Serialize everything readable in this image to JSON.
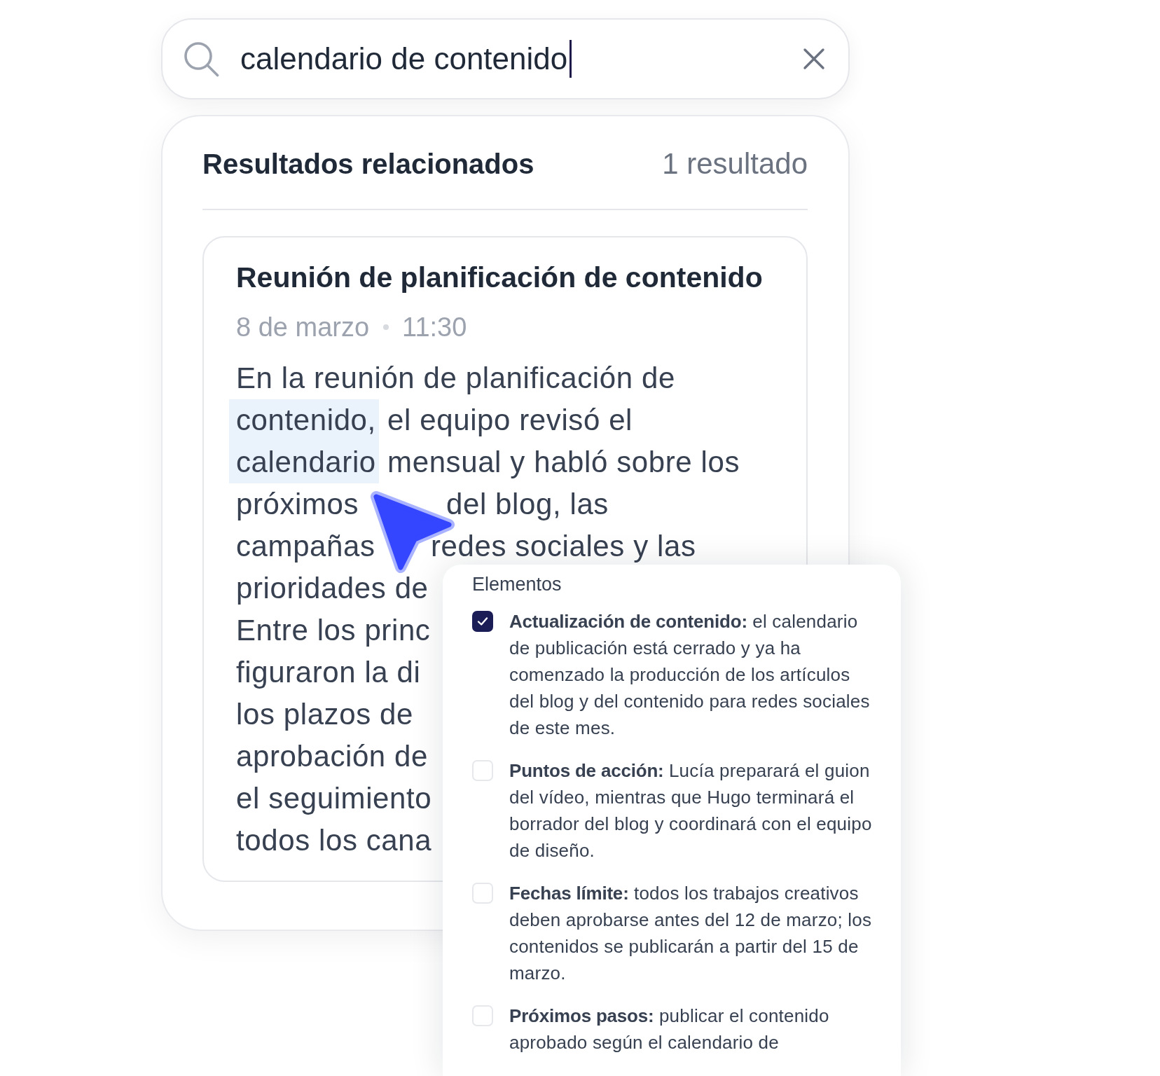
{
  "search": {
    "value": "calendario de contenido",
    "focused": true
  },
  "results": {
    "title": "Resultados relacionados",
    "count": "1 resultado",
    "items": [
      {
        "title": "Reunión de planificación de contenido",
        "date": "8 de marzo",
        "time": "11:30",
        "lines": [
          {
            "segments": [
              {
                "text": "En la reunión de planificación de",
                "highlighted": false
              }
            ]
          },
          {
            "segments": [
              {
                "text": "contenido,",
                "highlighted": true
              },
              {
                "text": "el equipo revisó el",
                "highlighted": false
              }
            ]
          },
          {
            "segments": [
              {
                "text": "calendario",
                "highlighted": true
              },
              {
                "text": "mensual y habló sobre los",
                "highlighted": false
              }
            ]
          },
          {
            "segments": [
              {
                "text": "próximos",
                "highlighted": false
              },
              {
                "text": "del blog, las",
                "highlighted": false
              }
            ]
          },
          {
            "segments": [
              {
                "text": "campañas",
                "highlighted": false
              },
              {
                "text": "redes sociales y las",
                "highlighted": false
              }
            ]
          },
          {
            "segments": [
              {
                "text": "prioridades de",
                "highlighted": false
              }
            ]
          },
          {
            "segments": [
              {
                "text": "Entre los princ",
                "highlighted": false
              }
            ]
          },
          {
            "segments": [
              {
                "text": "figuraron la di",
                "highlighted": false
              }
            ]
          },
          {
            "segments": [
              {
                "text": "los plazos de",
                "highlighted": false
              }
            ]
          },
          {
            "segments": [
              {
                "text": "aprobación de",
                "highlighted": false
              }
            ]
          },
          {
            "segments": [
              {
                "text": "el seguimiento",
                "highlighted": false
              }
            ]
          },
          {
            "segments": [
              {
                "text": "todos los cana",
                "highlighted": false
              }
            ]
          }
        ]
      }
    ]
  },
  "popover": {
    "title": "Elementos",
    "items": [
      {
        "text": "**Actualización de contenido:** el calendario de publicación está cerrado y ya ha comenzado la producción de los artículos del blog y del contenido para redes sociales de este mes.",
        "checked": true
      },
      {
        "text": "**Puntos de acción:** Lucía preparará el guion del vídeo, mientras que Hugo terminará el borrador del blog y coordinará con el equipo de diseño.",
        "checked": false
      },
      {
        "text": "**Fechas límite:** todos los trabajos creativos deben aprobarse antes del 12 de marzo; los contenidos se publicarán a partir del 15 de marzo.",
        "checked": false
      },
      {
        "text": "**Próximos pasos:** publicar el contenido aprobado según el calendario de",
        "checked": false
      }
    ]
  }
}
